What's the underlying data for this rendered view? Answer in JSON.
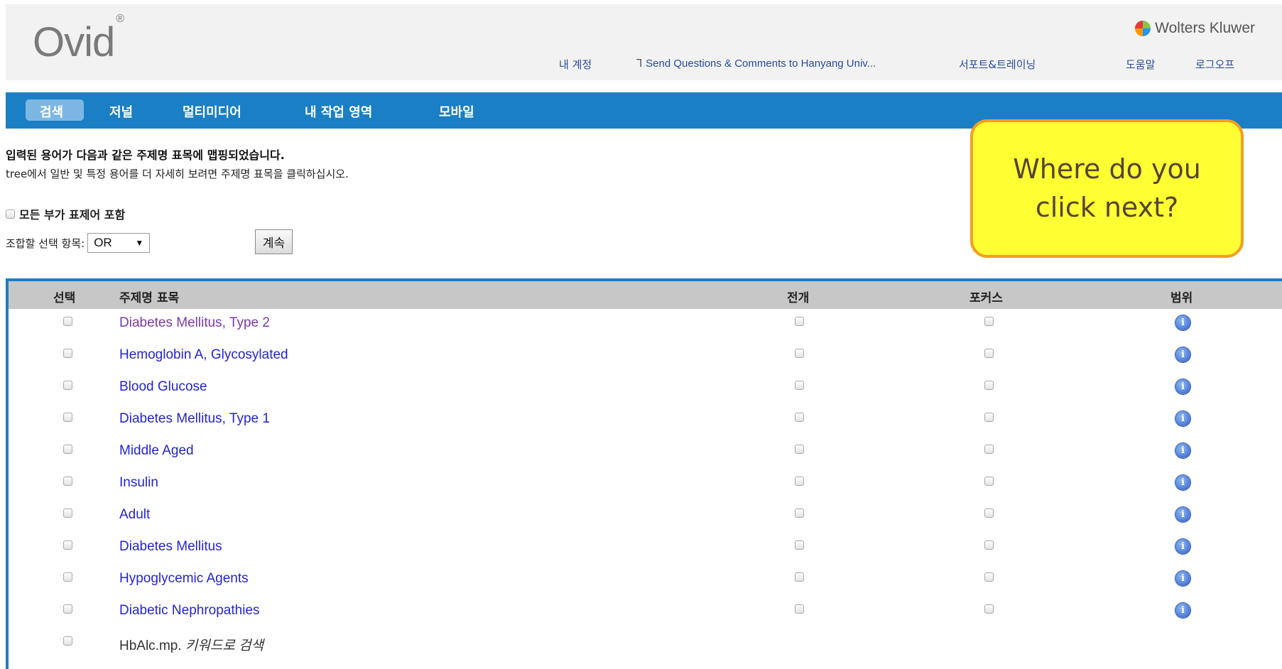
{
  "header": {
    "logo": "Ovid",
    "logo_mark": "®",
    "brand": "Wolters Kluwer",
    "brand_icon": "wolters-kluwer-logo-icon",
    "links": {
      "account": "내 계정",
      "feedback_icon": "question-people-icon",
      "feedback": "Send Questions & Comments to Hanyang Univ...",
      "support": "서포트&트레이닝",
      "help": "도움말",
      "logout": "로그오프"
    }
  },
  "nav": {
    "items": [
      "검색",
      "저널",
      "멀티미디어",
      "내 작업 영역",
      "모바일"
    ],
    "active_index": 0,
    "bar_color": "#1a7fc4"
  },
  "main": {
    "message_title": "입력된 용어가 다음과 같은 주제명 표목에 맵핑되었습니다.",
    "message_sub": "tree에서 일반 및 특정 용어를 더 자세히 보려면 주제명 표목을 클릭하십시오.",
    "include_all_label": "모든 부가 표제어 포함",
    "combine_label": "조합할 선택 항목:",
    "combine_value": "OR",
    "continue_label": "계속"
  },
  "callout": {
    "line1": "Where do you",
    "line2": "click next?",
    "fill_color": "#ffff33",
    "border_color": "#f0a020"
  },
  "table": {
    "headers": {
      "select": "선택",
      "subject": "주제명 표목",
      "explode": "전개",
      "focus": "포커스",
      "scope": "범위"
    },
    "scope_icon": "info-icon",
    "rows": [
      {
        "term": "Diabetes Mellitus, Type 2"
      },
      {
        "term": "Hemoglobin A, Glycosylated"
      },
      {
        "term": "Blood Glucose"
      },
      {
        "term": "Diabetes Mellitus, Type 1"
      },
      {
        "term": "Middle Aged"
      },
      {
        "term": "Insulin"
      },
      {
        "term": "Adult"
      },
      {
        "term": "Diabetes Mellitus"
      },
      {
        "term": "Hypoglycemic Agents"
      },
      {
        "term": "Diabetic Nephropathies"
      }
    ],
    "keyword_row": {
      "term": "HbAlc.mp.",
      "suffix": "키워드로 검색"
    }
  }
}
